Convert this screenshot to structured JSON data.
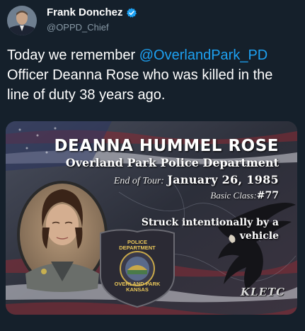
{
  "tweet": {
    "display_name": "Frank Donchez",
    "handle": "@OPPD_Chief",
    "text_before_mention": "Today we remember ",
    "mention": "@OverlandPark_PD",
    "text_after_mention": " Officer Deanna Rose who was killed in the line of duty 38 years ago."
  },
  "media": {
    "name": "DEANNA HUMMEL ROSE",
    "department": "Overland Park Police Department",
    "end_of_tour_label": "End of Tour:",
    "end_of_tour_date": "January 26, 1985",
    "basic_class_label": "Basic Class:",
    "basic_class_number": "#77",
    "cause": "Struck intentionally by a vehicle",
    "badge_top_line1": "POLICE",
    "badge_top_line2": "DEPARTMENT",
    "badge_bottom_line1": "OVERLAND PARK",
    "badge_bottom_line2": "KANSAS",
    "watermark": "KLETC"
  },
  "icons": {
    "verified": "verified-badge-icon",
    "badge": "police-badge-icon",
    "eagle": "eagle-silhouette-icon"
  },
  "colors": {
    "background": "#15202b",
    "mention": "#1da1f2",
    "handle": "#8899a6",
    "badge_gold": "#e8c65a"
  }
}
